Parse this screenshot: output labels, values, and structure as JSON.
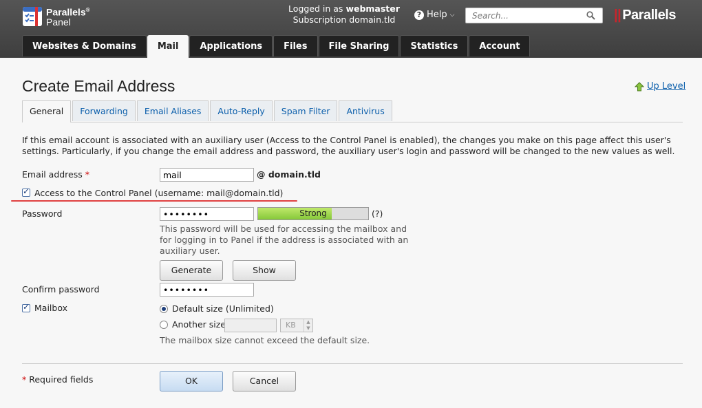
{
  "header": {
    "logo_line1": "Parallels",
    "logo_line2": "Panel",
    "logo_reg": "®",
    "logged_in_label": "Logged in as",
    "logged_in_user": "webmaster",
    "subscription_label": "Subscription",
    "subscription_value": "domain.tld",
    "help_label": "Help",
    "search_placeholder": "Search...",
    "brand": "Parallels"
  },
  "nav": {
    "tabs": [
      "Websites & Domains",
      "Mail",
      "Applications",
      "Files",
      "File Sharing",
      "Statistics",
      "Account"
    ],
    "active": "Mail"
  },
  "page": {
    "title": "Create Email Address",
    "up_level": "Up Level"
  },
  "subtabs": {
    "items": [
      "General",
      "Forwarding",
      "Email Aliases",
      "Auto-Reply",
      "Spam Filter",
      "Antivirus"
    ],
    "active": "General"
  },
  "info": "If this email account is associated with an auxiliary user (Access to the Control Panel is enabled), the changes you make on this page affect this user's settings. Particularly, if you change the email address and password, the auxiliary user's login and password will be changed to the new values as well.",
  "form": {
    "email_label": "Email address",
    "required_mark": "*",
    "email_value": "mail",
    "email_domain": "@ domain.tld",
    "access_label": "Access to the Control Panel (username: mail@domain.tld)",
    "access_checked": true,
    "password_label": "Password",
    "password_value": "••••••••",
    "strength_label": "Strong",
    "strength_fraction": 0.67,
    "strength_help": "(?)",
    "password_hint": "This password will be used for accessing the mailbox and for logging in to Panel if the address is associated with an auxiliary user.",
    "generate_label": "Generate",
    "show_label": "Show",
    "confirm_label": "Confirm password",
    "confirm_value": "••••••••",
    "mailbox_label": "Mailbox",
    "mailbox_checked": true,
    "default_size_label": "Default size (Unlimited)",
    "another_size_label": "Another size",
    "size_unit": "KB",
    "mailbox_hint": "The mailbox size cannot exceed the default size.",
    "required_note": "Required fields",
    "ok_label": "OK",
    "cancel_label": "Cancel"
  },
  "colors": {
    "header_bg": "#3e3e3e",
    "link": "#0a5eab",
    "required": "#cc0000",
    "brand_accent": "#c8252c",
    "strength": "#86c83a"
  }
}
